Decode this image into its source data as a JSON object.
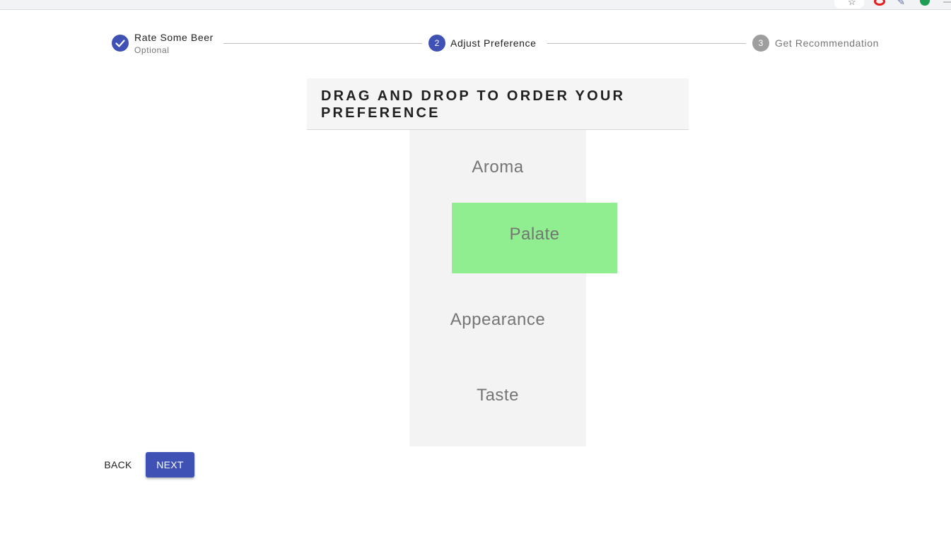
{
  "browser": {
    "toolbar_icons": [
      "star-icon",
      "opera-icon",
      "pen-icon",
      "leaf-icon",
      "menu-icon"
    ]
  },
  "stepper": {
    "steps": [
      {
        "index": "1",
        "icon": "check-icon",
        "label": "Rate Some Beer",
        "sublabel": "Optional",
        "state": "completed"
      },
      {
        "index": "2",
        "label": "Adjust Preference",
        "state": "active"
      },
      {
        "index": "3",
        "label": "Get Recommendation",
        "state": "inactive"
      }
    ]
  },
  "card": {
    "title": "Drag and Drop to Order Your Preference"
  },
  "preferences": {
    "items": [
      "Aroma",
      "Appearance",
      "Taste"
    ],
    "dragging": "Palate"
  },
  "actions": {
    "back_label": "Back",
    "next_label": "Next"
  },
  "colors": {
    "primary": "#3f51b5",
    "inactive_step": "#9e9e9e",
    "drag_highlight": "#90ee90",
    "list_bg": "#f3f3f3"
  }
}
